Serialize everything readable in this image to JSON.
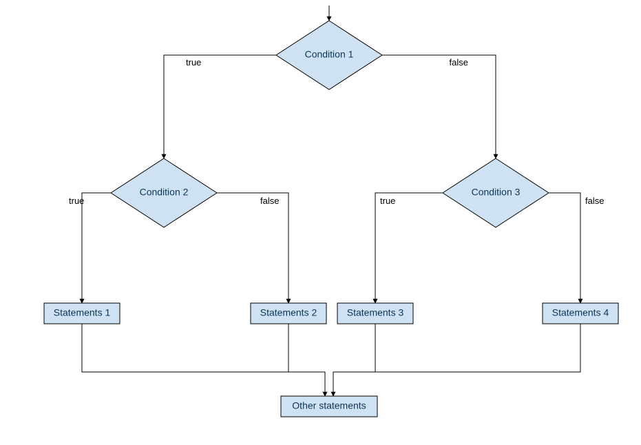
{
  "diagram": {
    "type": "flowchart",
    "nodes": {
      "cond1": {
        "label": "Condition 1",
        "shape": "diamond"
      },
      "cond2": {
        "label": "Condition 2",
        "shape": "diamond"
      },
      "cond3": {
        "label": "Condition 3",
        "shape": "diamond"
      },
      "stmt1": {
        "label": "Statements 1",
        "shape": "rect"
      },
      "stmt2": {
        "label": "Statements 2",
        "shape": "rect"
      },
      "stmt3": {
        "label": "Statements 3",
        "shape": "rect"
      },
      "stmt4": {
        "label": "Statements 4",
        "shape": "rect"
      },
      "other": {
        "label": "Other statements",
        "shape": "rect"
      }
    },
    "edges": {
      "c1_true": {
        "label": "true"
      },
      "c1_false": {
        "label": "false"
      },
      "c2_true": {
        "label": "true"
      },
      "c2_false": {
        "label": "false"
      },
      "c3_true": {
        "label": "true"
      },
      "c3_false": {
        "label": "false"
      }
    },
    "colors": {
      "node_fill": "#cfe2f3",
      "node_stroke": "#000000",
      "text": "#0b3556"
    }
  }
}
